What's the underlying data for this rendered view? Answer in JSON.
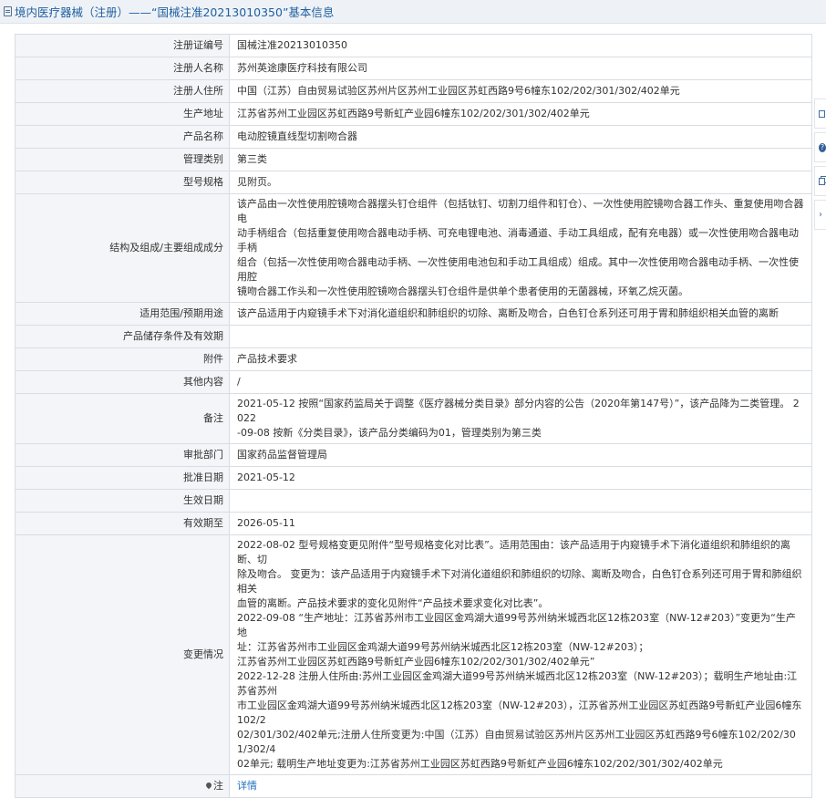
{
  "header": {
    "title": "境内医疗器械（注册）——“国械注准20213010350”基本信息"
  },
  "rows": [
    {
      "label": "注册证编号",
      "lines": [
        "国械注准20213010350"
      ]
    },
    {
      "label": "注册人名称",
      "lines": [
        "苏州英途康医疗科技有限公司"
      ]
    },
    {
      "label": "注册人住所",
      "lines": [
        "中国（江苏）自由贸易试验区苏州片区苏州工业园区苏虹西路9号6幢东102/202/301/302/402单元"
      ]
    },
    {
      "label": "生产地址",
      "lines": [
        "江苏省苏州工业园区苏虹西路9号新虹产业园6幢东102/202/301/302/402单元"
      ]
    },
    {
      "label": "产品名称",
      "lines": [
        "电动腔镜直线型切割吻合器"
      ]
    },
    {
      "label": "管理类别",
      "lines": [
        "第三类"
      ]
    },
    {
      "label": "型号规格",
      "lines": [
        "见附页。"
      ]
    },
    {
      "label": "结构及组成/主要组成成分",
      "lines": [
        "该产品由一次性使用腔镜吻合器摆头钉仓组件（包括钛钉、切割刀组件和钉仓）、一次性使用腔镜吻合器工作头、重复使用吻合器电",
        "动手柄组合（包括重复使用吻合器电动手柄、可充电锂电池、消毒通道、手动工具组成，配有充电器）或一次性使用吻合器电动手柄",
        "组合（包括一次性使用吻合器电动手柄、一次性使用电池包和手动工具组成）组成。其中一次性使用吻合器电动手柄、一次性使用腔",
        "镜吻合器工作头和一次性使用腔镜吻合器摆头钉仓组件是供单个患者使用的无菌器械，环氧乙烷灭菌。"
      ]
    },
    {
      "label": "适用范围/预期用途",
      "lines": [
        "该产品适用于内窥镜手术下对消化道组织和肺组织的切除、离断及吻合，白色钉仓系列还可用于胃和肺组织相关血管的离断"
      ]
    },
    {
      "label": "产品储存条件及有效期",
      "lines": []
    },
    {
      "label": "附件",
      "lines": [
        "产品技术要求"
      ]
    },
    {
      "label": "其他内容",
      "lines": [
        "/"
      ]
    },
    {
      "label": "备注",
      "lines": [
        "2021-05-12 按照“国家药监局关于调整《医疗器械分类目录》部分内容的公告（2020年第147号）”，该产品降为二类管理。 2022",
        "-09-08 按新《分类目录》，该产品分类编码为01，管理类别为第三类"
      ]
    },
    {
      "label": "审批部门",
      "lines": [
        "国家药品监督管理局"
      ]
    },
    {
      "label": "批准日期",
      "lines": [
        "2021-05-12"
      ]
    },
    {
      "label": "生效日期",
      "lines": []
    },
    {
      "label": "有效期至",
      "lines": [
        "2026-05-11"
      ]
    },
    {
      "label": "变更情况",
      "lines": [
        "2022-08-02 型号规格变更见附件“型号规格变化对比表”。适用范围由：该产品适用于内窥镜手术下消化道组织和肺组织的离断、切",
        "除及吻合。 变更为：该产品适用于内窥镜手术下对消化道组织和肺组织的切除、离断及吻合，白色钉仓系列还可用于胃和肺组织相关",
        "血管的离断。产品技术要求的变化见附件“产品技术要求变化对比表”。",
        "2022-09-08 “生产地址：江苏省苏州市工业园区金鸡湖大道99号苏州纳米城西北区12栋203室（NW-12#203）”变更为“生产地",
        "址：江苏省苏州市工业园区金鸡湖大道99号苏州纳米城西北区12栋203室（NW-12#203）；",
        "江苏省苏州工业园区苏虹西路9号新虹产业园6幢东102/202/301/302/402单元”",
        "2022-12-28 注册人住所由:苏州工业园区金鸡湖大道99号苏州纳米城西北区12栋203室（NW-12#203）；载明生产地址由:江苏省苏州",
        "市工业园区金鸡湖大道99号苏州纳米城西北区12栋203室（NW-12#203），江苏省苏州工业园区苏虹西路9号新虹产业园6幢东102/2",
        "02/301/302/402单元;注册人住所变更为:中国（江苏）自由贸易试验区苏州片区苏州工业园区苏虹西路9号6幢东102/202/301/302/4",
        "02单元; 载明生产地址变更为:江苏省苏州工业园区苏虹西路9号新虹产业园6幢东102/202/301/302/402单元"
      ]
    }
  ],
  "note_row": {
    "label": "注",
    "link_text": "详情"
  },
  "side_tools": [
    {
      "icon": "edit-icon"
    },
    {
      "icon": "help-icon",
      "glyph": "?"
    },
    {
      "icon": "copy-icon"
    },
    {
      "icon": "chevron-right-icon",
      "glyph": "›"
    }
  ],
  "colors": {
    "title_text": "#1f5fa0",
    "label_bg": "#f3f5f8",
    "border": "#d8dde3",
    "link": "#1f6fbf"
  }
}
